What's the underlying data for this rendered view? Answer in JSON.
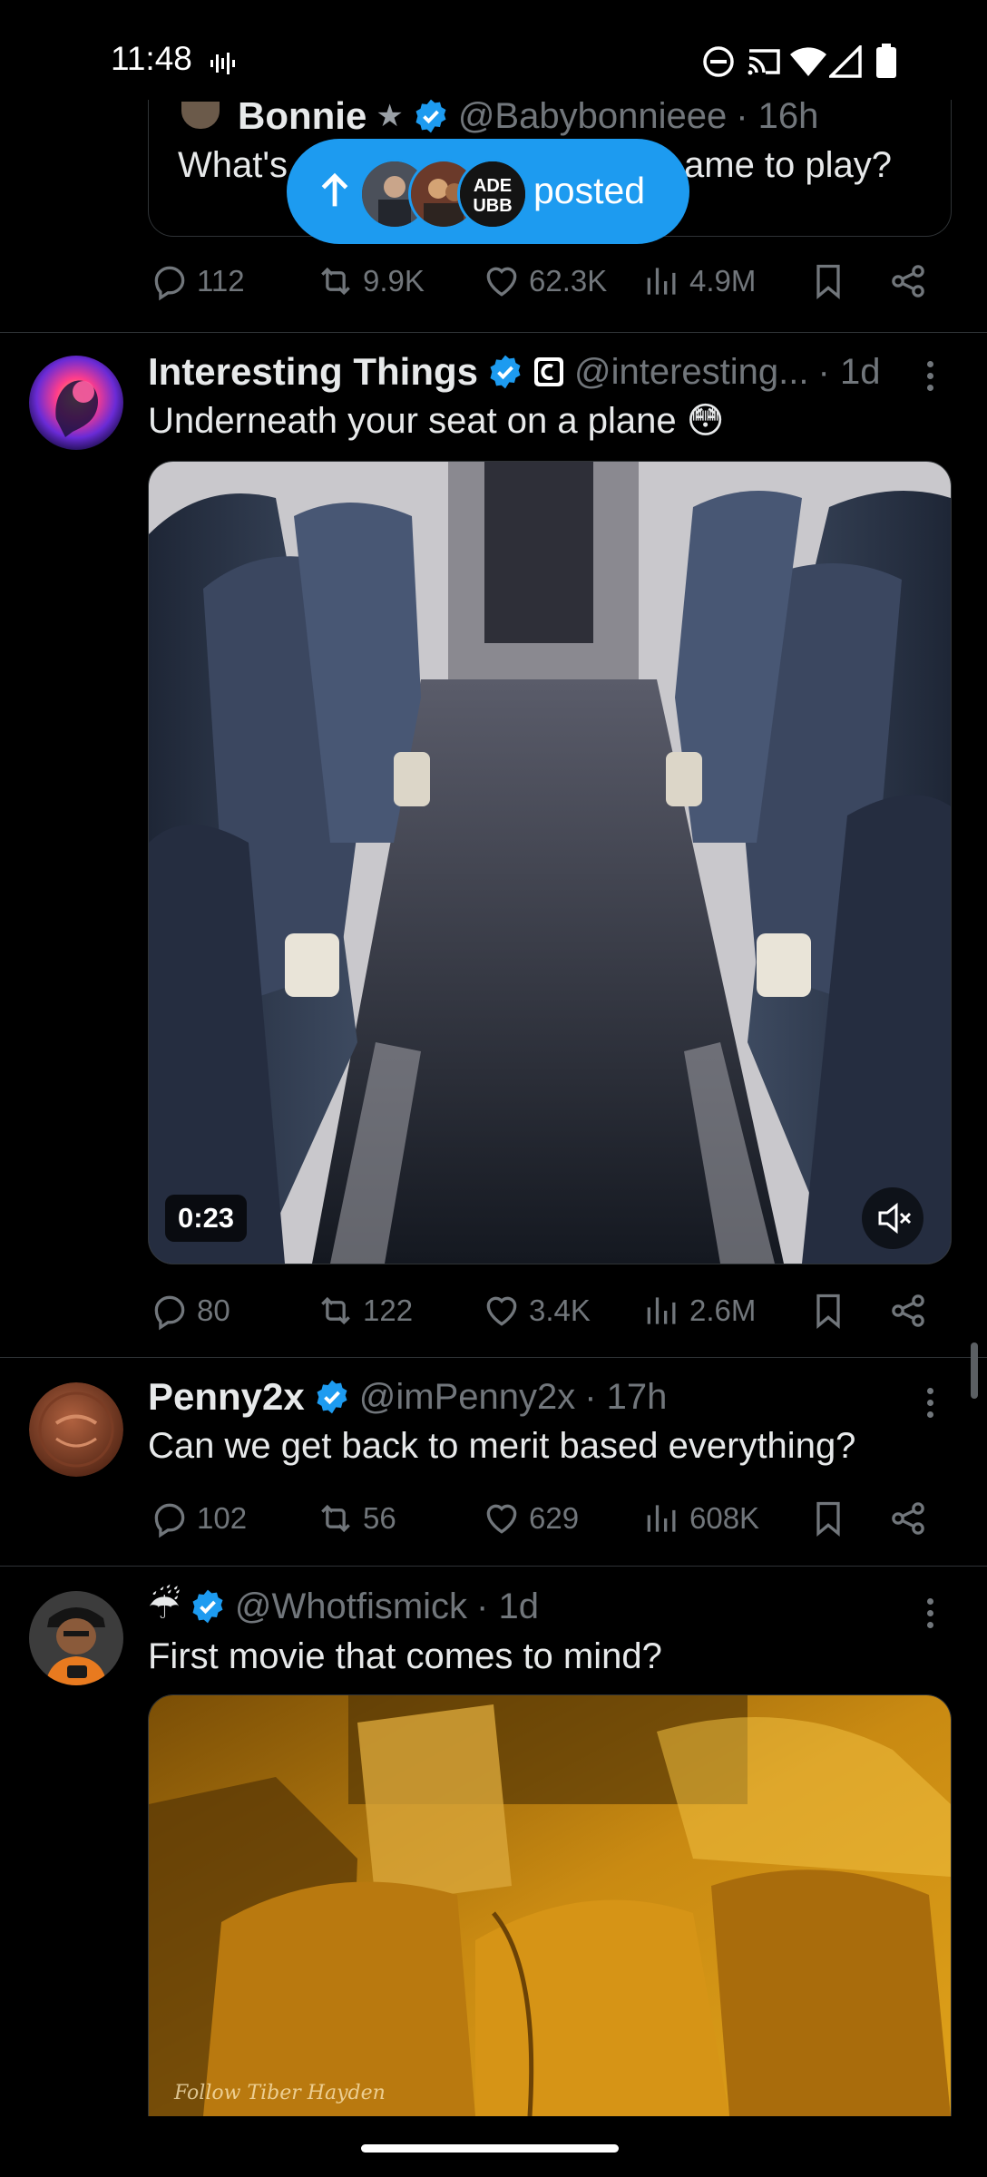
{
  "status_bar": {
    "time": "11:48",
    "icons": [
      "voice-icon",
      "dnd-icon",
      "cast-icon",
      "wifi-icon",
      "signal-icon",
      "battery-icon"
    ]
  },
  "posted_pill": {
    "label": "posted",
    "avatar_3_text": "ADE\nUBB"
  },
  "tweets": [
    {
      "name": "Bonnie",
      "handle": "@Babybonnieee",
      "time": "· 16h",
      "quote_text_left": "What's",
      "quote_text_right": "ame to play?",
      "metrics": {
        "replies": "112",
        "reposts": "9.9K",
        "likes": "62.3K",
        "views": "4.9M"
      }
    },
    {
      "name": "Interesting Things",
      "handle": "@interesting...",
      "time": "· 1d",
      "text": "Underneath your seat on a plane 😳",
      "video_duration": "0:23",
      "metrics": {
        "replies": "80",
        "reposts": "122",
        "likes": "3.4K",
        "views": "2.6M"
      }
    },
    {
      "name": "Penny2x",
      "handle": "@imPenny2x",
      "time": "· 17h",
      "text": "Can we get back to merit based everything?",
      "metrics": {
        "replies": "102",
        "reposts": "56",
        "likes": "629",
        "views": "608K"
      }
    },
    {
      "name": "☔",
      "handle": "@Whotfismick",
      "time": "· 1d",
      "text": "First movie that comes to mind?",
      "media_watermark": "Follow Tiber Hayden"
    }
  ],
  "colors": {
    "background": "#000000",
    "accent": "#1d9bf0",
    "text_primary": "#e7e9ea",
    "text_secondary": "#71767b",
    "divider": "#2f3336"
  }
}
